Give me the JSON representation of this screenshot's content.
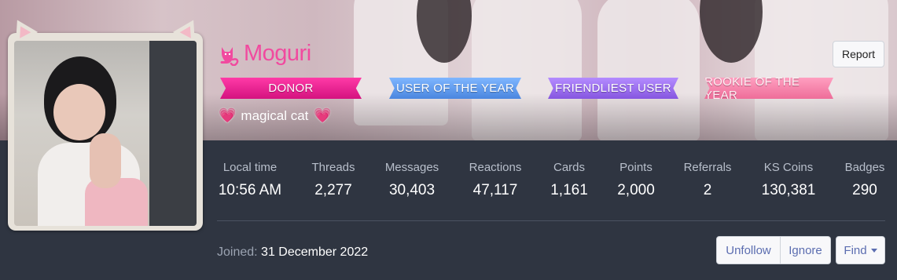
{
  "profile": {
    "username": "Moguri",
    "status": "magical cat",
    "ribbons": {
      "donor": "Donor",
      "user_of_year": "User of the Year",
      "friendliest": "Friendliest User",
      "rookie": "Rookie of the Year"
    },
    "colors": {
      "name": "#f14a9f",
      "accent_link": "#5b6db0"
    }
  },
  "actions": {
    "report": "Report",
    "unfollow": "Unfollow",
    "ignore": "Ignore",
    "find": "Find"
  },
  "stats": [
    {
      "label": "Local time",
      "value": "10:56 AM"
    },
    {
      "label": "Threads",
      "value": "2,277"
    },
    {
      "label": "Messages",
      "value": "30,403"
    },
    {
      "label": "Reactions",
      "value": "47,117"
    },
    {
      "label": "Cards",
      "value": "1,161"
    },
    {
      "label": "Points",
      "value": "2,000"
    },
    {
      "label": "Referrals",
      "value": "2"
    },
    {
      "label": "KS Coins",
      "value": "130,381"
    },
    {
      "label": "Badges",
      "value": "290"
    }
  ],
  "joined": {
    "label": "Joined:",
    "date": "31 December 2022"
  },
  "icons": {
    "name_prefix": "cat-icon",
    "status_decor": "heart-icon",
    "find_caret": "caret-down-icon"
  }
}
